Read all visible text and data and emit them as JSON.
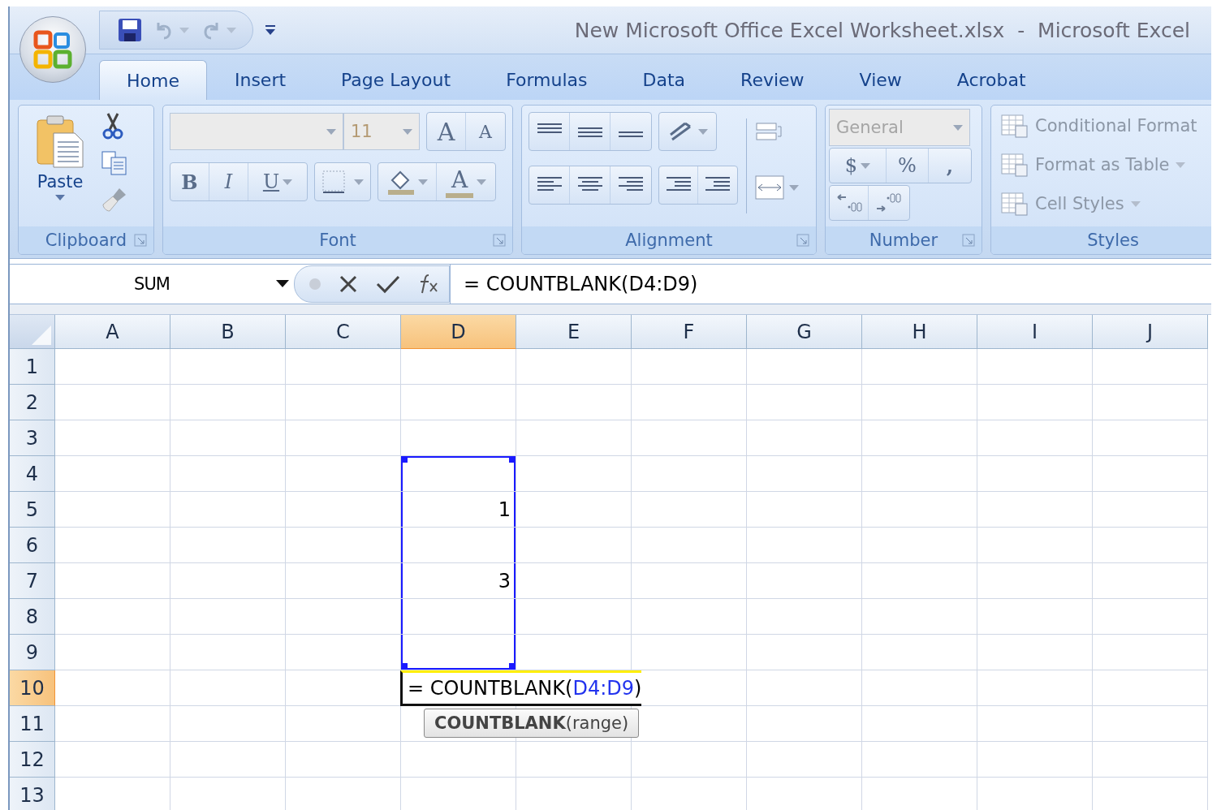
{
  "window": {
    "title": "New Microsoft Office Excel Worksheet.xlsx  -  Microsoft Excel"
  },
  "tabs": [
    {
      "label": "Home",
      "selected": true
    },
    {
      "label": "Insert",
      "selected": false
    },
    {
      "label": "Page Layout",
      "selected": false
    },
    {
      "label": "Formulas",
      "selected": false
    },
    {
      "label": "Data",
      "selected": false
    },
    {
      "label": "Review",
      "selected": false
    },
    {
      "label": "View",
      "selected": false
    },
    {
      "label": "Acrobat",
      "selected": false
    }
  ],
  "ribbon": {
    "clipboard": {
      "label": "Clipboard",
      "paste": "Paste"
    },
    "font": {
      "label": "Font",
      "size": "11",
      "grow": "A",
      "shrink": "A",
      "bold": "B",
      "italic": "I",
      "underline": "U",
      "font_color": "A"
    },
    "alignment": {
      "label": "Alignment"
    },
    "number": {
      "label": "Number",
      "format": "General",
      "currency": "$",
      "percent": "%",
      "comma": ","
    },
    "styles": {
      "label": "Styles",
      "items": [
        {
          "label": "Conditional Format",
          "dropdown": false
        },
        {
          "label": "Format as Table",
          "dropdown": true
        },
        {
          "label": "Cell Styles",
          "dropdown": true
        }
      ]
    }
  },
  "formula_bar": {
    "name_box": "SUM",
    "formula": "= COUNTBLANK(D4:D9)"
  },
  "columns": [
    {
      "label": "A",
      "selected": false
    },
    {
      "label": "B",
      "selected": false
    },
    {
      "label": "C",
      "selected": false
    },
    {
      "label": "D",
      "selected": true
    },
    {
      "label": "E",
      "selected": false
    },
    {
      "label": "F",
      "selected": false
    },
    {
      "label": "G",
      "selected": false
    },
    {
      "label": "H",
      "selected": false
    },
    {
      "label": "I",
      "selected": false
    },
    {
      "label": "J",
      "selected": false
    }
  ],
  "rows": [
    {
      "label": "1",
      "selected": false,
      "referenced": false
    },
    {
      "label": "2",
      "selected": false,
      "referenced": false
    },
    {
      "label": "3",
      "selected": false,
      "referenced": false
    },
    {
      "label": "4",
      "selected": false,
      "referenced": true
    },
    {
      "label": "5",
      "selected": false,
      "referenced": true,
      "cells": {
        "d": {
          "kind": "number",
          "value": "1"
        }
      }
    },
    {
      "label": "6",
      "selected": false,
      "referenced": true
    },
    {
      "label": "7",
      "selected": false,
      "referenced": true,
      "cells": {
        "d": {
          "kind": "number",
          "value": "3"
        }
      }
    },
    {
      "label": "8",
      "selected": false,
      "referenced": true
    },
    {
      "label": "9",
      "selected": false,
      "referenced": true
    },
    {
      "label": "10",
      "selected": true,
      "referenced": false,
      "cells": {
        "d": {
          "kind": "formula",
          "prefix": "= COUNTBLANK(",
          "reference": "D4:D9",
          "suffix": ")",
          "hint": "**COUNTBLANK**(range)"
        }
      }
    },
    {
      "label": "11",
      "selected": false,
      "referenced": false
    },
    {
      "label": "12",
      "selected": false,
      "referenced": false
    },
    {
      "label": "13",
      "selected": false,
      "referenced": false
    }
  ]
}
